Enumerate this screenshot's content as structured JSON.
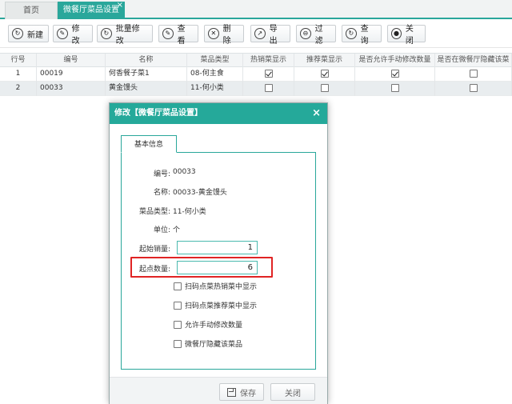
{
  "tabs": {
    "home": "首页",
    "active": "微餐厅菜品设置",
    "close": "×"
  },
  "toolbar": {
    "new": "新建",
    "edit": "修改",
    "batch_edit": "批量修改",
    "view": "查看",
    "delete": "删除",
    "export": "导出",
    "filter": "过滤",
    "query": "查询",
    "close": "关闭"
  },
  "grid": {
    "headers": [
      "行号",
      "编号",
      "名称",
      "菜品类型",
      "热销菜显示",
      "推荐菜显示",
      "是否允许手动修改数量",
      "是否在微餐厅隐藏该菜"
    ],
    "rows": [
      {
        "no": "1",
        "code": "00019",
        "name": "何香餐子菜1",
        "type": "08-何主食",
        "hot": true,
        "recommend": true,
        "manual": true,
        "hidden": false
      },
      {
        "no": "2",
        "code": "00033",
        "name": "黄金馒头",
        "type": "11-何小类",
        "hot": false,
        "recommend": false,
        "manual": false,
        "hidden": false
      }
    ]
  },
  "modal": {
    "title": "修改【微餐厅菜品设置】",
    "close": "×",
    "tab": "基本信息",
    "fields": {
      "code_label": "编号:",
      "code_value": "00033",
      "name_label": "名称:",
      "name_value": "00033-黄金馒头",
      "type_label": "菜品类型:",
      "type_value": "11-何小类",
      "unit_label": "单位:",
      "unit_value": "个",
      "min_sale_label": "起始销量:",
      "min_sale_value": "1",
      "min_order_label": "起点数量:",
      "min_order_value": "6"
    },
    "checkboxes": [
      "扫码点菜热销菜中显示",
      "扫码点菜推荐菜中显示",
      "允许手动修改数量",
      "微餐厅隐藏该菜品"
    ],
    "save": "保存",
    "close_button": "关闭"
  },
  "colors": {
    "accent": "#2aa79b",
    "highlight": "#e02424"
  }
}
